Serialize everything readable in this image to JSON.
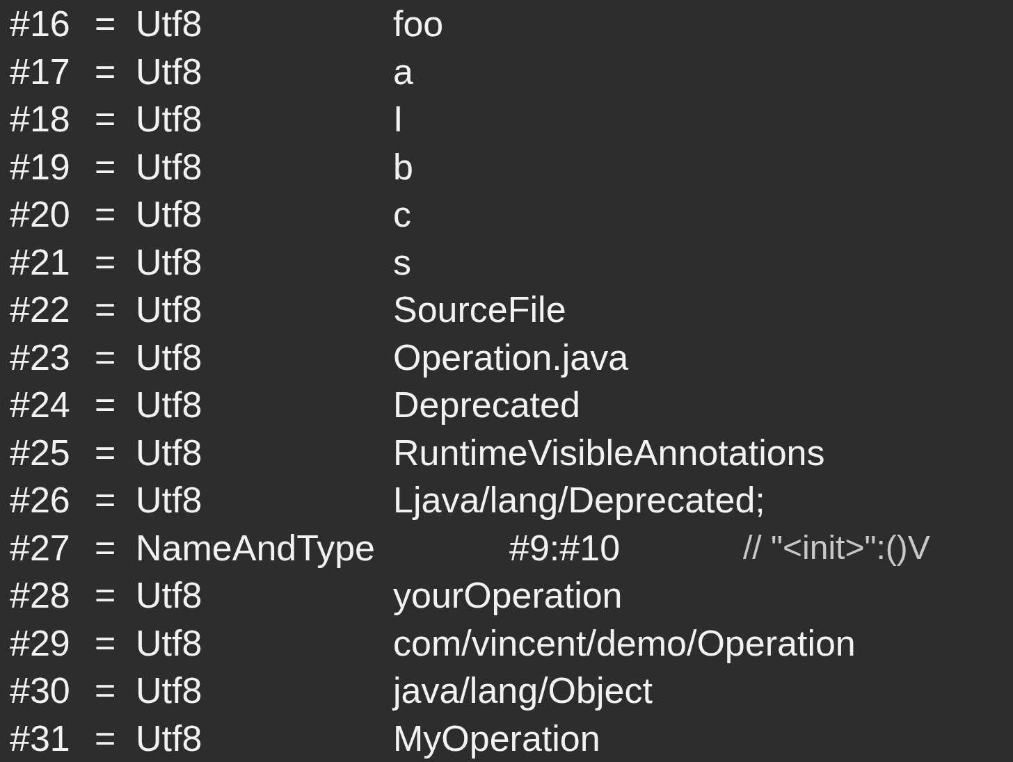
{
  "rows": [
    {
      "kind": "entry",
      "index": "#16",
      "separator": "=",
      "type": "Utf8",
      "value": "foo"
    },
    {
      "kind": "entry",
      "index": "#17",
      "separator": "=",
      "type": "Utf8",
      "value": "a"
    },
    {
      "kind": "entry",
      "index": "#18",
      "separator": "=",
      "type": "Utf8",
      "value": "I"
    },
    {
      "kind": "entry",
      "index": "#19",
      "separator": "=",
      "type": "Utf8",
      "value": "b"
    },
    {
      "kind": "entry",
      "index": "#20",
      "separator": "=",
      "type": "Utf8",
      "value": "c"
    },
    {
      "kind": "entry",
      "index": "#21",
      "separator": "=",
      "type": "Utf8",
      "value": "s"
    },
    {
      "kind": "entry",
      "index": "#22",
      "separator": "=",
      "type": "Utf8",
      "value": "SourceFile"
    },
    {
      "kind": "entry",
      "index": "#23",
      "separator": "=",
      "type": "Utf8",
      "value": "Operation.java"
    },
    {
      "kind": "entry",
      "index": "#24",
      "separator": "=",
      "type": "Utf8",
      "value": "Deprecated"
    },
    {
      "kind": "entry",
      "index": "#25",
      "separator": "=",
      "type": "Utf8",
      "value": "RuntimeVisibleAnnotations"
    },
    {
      "kind": "entry",
      "index": "#26",
      "separator": "=",
      "type": "Utf8",
      "value": "Ljava/lang/Deprecated;"
    },
    {
      "kind": "reference",
      "index": "#27",
      "separator": "=",
      "type": "NameAndType",
      "value": "#9:#10",
      "comment": "// \"<init>\":()V"
    },
    {
      "kind": "entry",
      "index": "#28",
      "separator": "=",
      "type": "Utf8",
      "value": "yourOperation"
    },
    {
      "kind": "entry",
      "index": "#29",
      "separator": "=",
      "type": "Utf8",
      "value": "com/vincent/demo/Operation"
    },
    {
      "kind": "entry",
      "index": "#30",
      "separator": "=",
      "type": "Utf8",
      "value": "java/lang/Object"
    },
    {
      "kind": "entry",
      "index": "#31",
      "separator": "=",
      "type": "Utf8",
      "value": "MyOperation"
    }
  ]
}
